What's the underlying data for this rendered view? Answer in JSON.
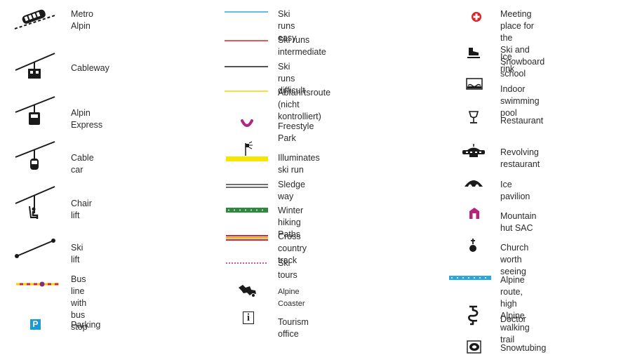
{
  "legend": {
    "col1": [
      {
        "label": "Metro Alpin",
        "icon": "metro-alpin-icon"
      },
      {
        "label": "Cableway",
        "icon": "cableway-icon"
      },
      {
        "label": "Alpin Express",
        "icon": "alpin-express-icon"
      },
      {
        "label": "Cable car",
        "icon": "cable-car-icon"
      },
      {
        "label": "Chair lift",
        "icon": "chair-lift-icon"
      },
      {
        "label": "Ski lift",
        "icon": "ski-lift-icon"
      },
      {
        "label": "Bus line\nwith bus stop",
        "icon": "bus-line-icon"
      },
      {
        "label": "Parking",
        "icon": "parking-icon",
        "glyph": "P"
      }
    ],
    "col2": [
      {
        "label": "Ski runs easy",
        "icon": "ski-run-easy-line",
        "color": "#2aa7e0"
      },
      {
        "label": "Ski runs intermediate",
        "icon": "ski-run-intermediate-line",
        "color": "#d8232a"
      },
      {
        "label": "Ski runs difficult",
        "icon": "ski-run-difficult-line",
        "color": "#1a1a1a"
      },
      {
        "label": "Abfahrtsroute\n(nicht kontrolliert)",
        "icon": "abfahrtsroute-line",
        "color": "#f5d200"
      },
      {
        "label": "Freestyle Park",
        "icon": "freestyle-park-icon",
        "color": "#b5257a"
      },
      {
        "label": "Illuminates ski run",
        "icon": "illuminated-ski-run-icon",
        "color": "#f5e600"
      },
      {
        "label": "Sledge way",
        "icon": "sledge-way-line"
      },
      {
        "label": "Winter hiking Paths",
        "icon": "winter-hiking-line",
        "color": "#2e8b3e"
      },
      {
        "label": "Cross country track",
        "icon": "cross-country-line",
        "color": "#e8641e"
      },
      {
        "label": "Ski tours",
        "icon": "ski-tours-line",
        "color": "#b5257a"
      },
      {
        "label": "Alpine Coaster",
        "icon": "alpine-coaster-icon"
      },
      {
        "label": "Tourism office",
        "icon": "tourism-office-icon",
        "glyph": "i"
      }
    ],
    "col3": [
      {
        "label": "Meeting place for the\nSki and Snowboard school",
        "icon": "meeting-place-icon",
        "color": "#d8232a"
      },
      {
        "label": "Ice rink",
        "icon": "ice-rink-icon"
      },
      {
        "label": "Indoor swimming pool",
        "icon": "indoor-pool-icon"
      },
      {
        "label": "Restaurant",
        "icon": "restaurant-icon"
      },
      {
        "label": "Revolving restaurant",
        "icon": "revolving-restaurant-icon"
      },
      {
        "label": "Ice pavilion",
        "icon": "ice-pavilion-icon"
      },
      {
        "label": "Mountain hut SAC",
        "icon": "mountain-hut-icon",
        "color": "#b5257a"
      },
      {
        "label": "Church worth seeing",
        "icon": "church-icon"
      },
      {
        "label": "Alpine route, high Alpine walking\ntrail",
        "icon": "alpine-route-line",
        "color": "#2aa7e0"
      },
      {
        "label": "Doctor",
        "icon": "doctor-icon"
      },
      {
        "label": "Snowtubing",
        "icon": "snowtubing-icon"
      }
    ]
  }
}
